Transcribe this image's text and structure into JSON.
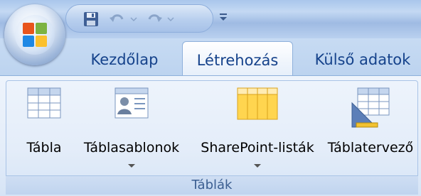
{
  "quick_access": {
    "items": [
      {
        "icon": "save-icon"
      },
      {
        "icon": "undo-icon"
      },
      {
        "icon": "redo-icon"
      },
      {
        "icon": "customize-qat-icon"
      }
    ]
  },
  "office_button": {
    "icon": "office-logo-icon"
  },
  "tabs": [
    {
      "label": "Kezdőlap",
      "active": false
    },
    {
      "label": "Létrehozás",
      "active": true
    },
    {
      "label": "Külső adatok",
      "active": false
    }
  ],
  "ribbon": {
    "group": {
      "label": "Táblák",
      "buttons": [
        {
          "label": "Tábla",
          "icon": "table-icon",
          "has_dropdown": false
        },
        {
          "label": "Táblasablonok",
          "icon": "table-templates-icon",
          "has_dropdown": true
        },
        {
          "label": "SharePoint-listák",
          "icon": "sharepoint-lists-icon",
          "has_dropdown": true
        },
        {
          "label": "Táblatervező",
          "icon": "table-design-icon",
          "has_dropdown": false
        }
      ]
    }
  },
  "colors": {
    "tab_text": "#15428b",
    "ribbon_bg": "#e4edf9",
    "group_label": "#3b5e91"
  }
}
